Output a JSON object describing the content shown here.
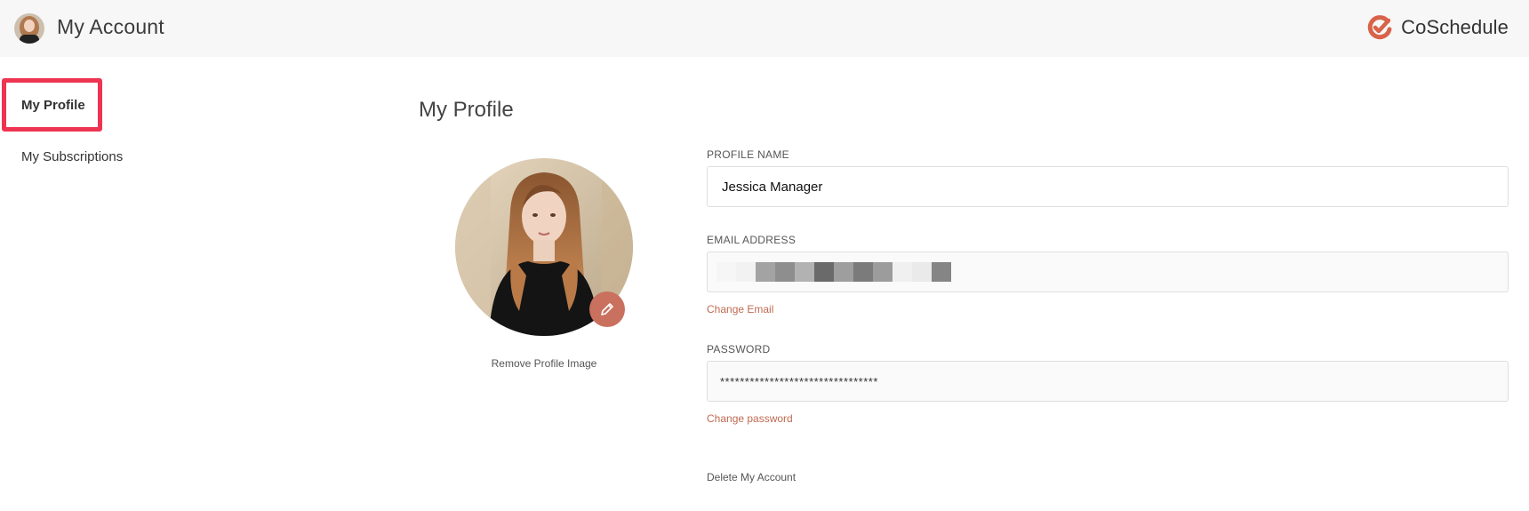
{
  "header": {
    "title": "My Account",
    "brand_name": "CoSchedule",
    "brand_color": "#d9624a"
  },
  "sidebar": {
    "items": [
      {
        "label": "My Profile",
        "active": true
      },
      {
        "label": "My Subscriptions",
        "active": false
      }
    ],
    "highlight_color": "#ee3451"
  },
  "main": {
    "title": "My Profile",
    "remove_image_label": "Remove Profile Image",
    "profile_name": {
      "label": "PROFILE NAME",
      "value": "Jessica Manager"
    },
    "email": {
      "label": "EMAIL ADDRESS",
      "value": "",
      "redacted": true,
      "change_label": "Change Email"
    },
    "password": {
      "label": "PASSWORD",
      "value": "********************************",
      "change_label": "Change password"
    },
    "delete_label": "Delete My Account",
    "accent_color": "#c06a52",
    "edit_icon": "pencil-icon"
  }
}
